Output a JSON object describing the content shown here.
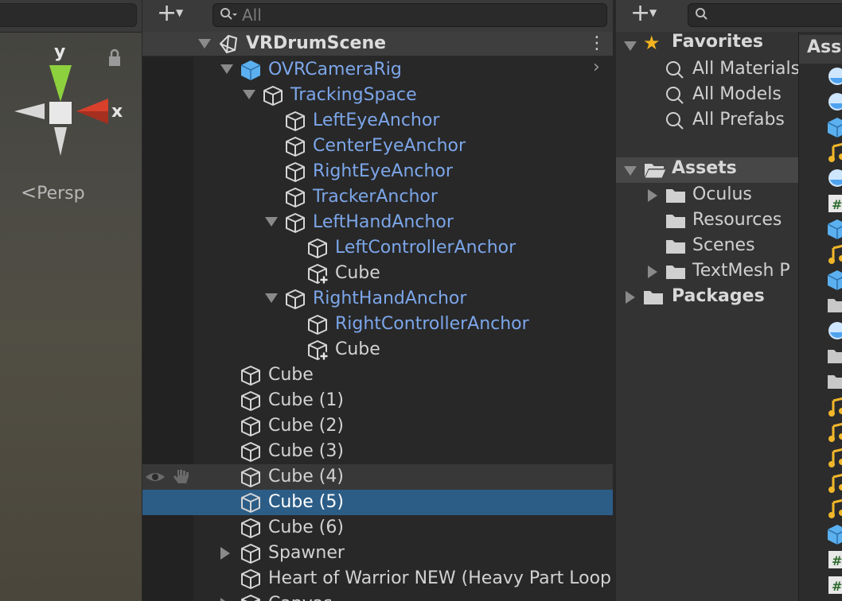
{
  "scene_view": {
    "gizmo_y": "y",
    "gizmo_x": "x",
    "projection_label": "Persp",
    "lock_icon": "lock-icon"
  },
  "hierarchy": {
    "search_placeholder": "All",
    "scene_name": "VRDrumScene",
    "rows": [
      {
        "label": "OVRCameraRig",
        "kind": "prefab-root"
      },
      {
        "label": "TrackingSpace",
        "kind": "prefab"
      },
      {
        "label": "LeftEyeAnchor",
        "kind": "prefab"
      },
      {
        "label": "CenterEyeAnchor",
        "kind": "prefab"
      },
      {
        "label": "RightEyeAnchor",
        "kind": "prefab"
      },
      {
        "label": "TrackerAnchor",
        "kind": "prefab"
      },
      {
        "label": "LeftHandAnchor",
        "kind": "prefab"
      },
      {
        "label": "LeftControllerAnchor",
        "kind": "prefab"
      },
      {
        "label": "Cube",
        "kind": "added"
      },
      {
        "label": "RightHandAnchor",
        "kind": "prefab"
      },
      {
        "label": "RightControllerAnchor",
        "kind": "prefab"
      },
      {
        "label": "Cube",
        "kind": "added"
      },
      {
        "label": "Cube",
        "kind": "plain"
      },
      {
        "label": "Cube (1)",
        "kind": "plain"
      },
      {
        "label": "Cube (2)",
        "kind": "plain"
      },
      {
        "label": "Cube (3)",
        "kind": "plain"
      },
      {
        "label": "Cube (4)",
        "kind": "plain",
        "hovered": true
      },
      {
        "label": "Cube (5)",
        "kind": "plain",
        "selected": true
      },
      {
        "label": "Cube (6)",
        "kind": "plain"
      },
      {
        "label": "Spawner",
        "kind": "plain"
      },
      {
        "label": "Heart of Warrior NEW (Heavy Part Loop",
        "kind": "plain"
      },
      {
        "label": "Canvas",
        "kind": "plain"
      }
    ]
  },
  "project": {
    "favorites_label": "Favorites",
    "favorites": [
      "All Materials",
      "All Models",
      "All Prefabs"
    ],
    "assets_label": "Assets",
    "asset_folders": [
      "Oculus",
      "Resources",
      "Scenes",
      "TextMesh P"
    ],
    "packages_label": "Packages",
    "grid_header": "Assets",
    "accent_blue": "#2c5d87",
    "prefab_text_color": "#7ca6ea"
  }
}
